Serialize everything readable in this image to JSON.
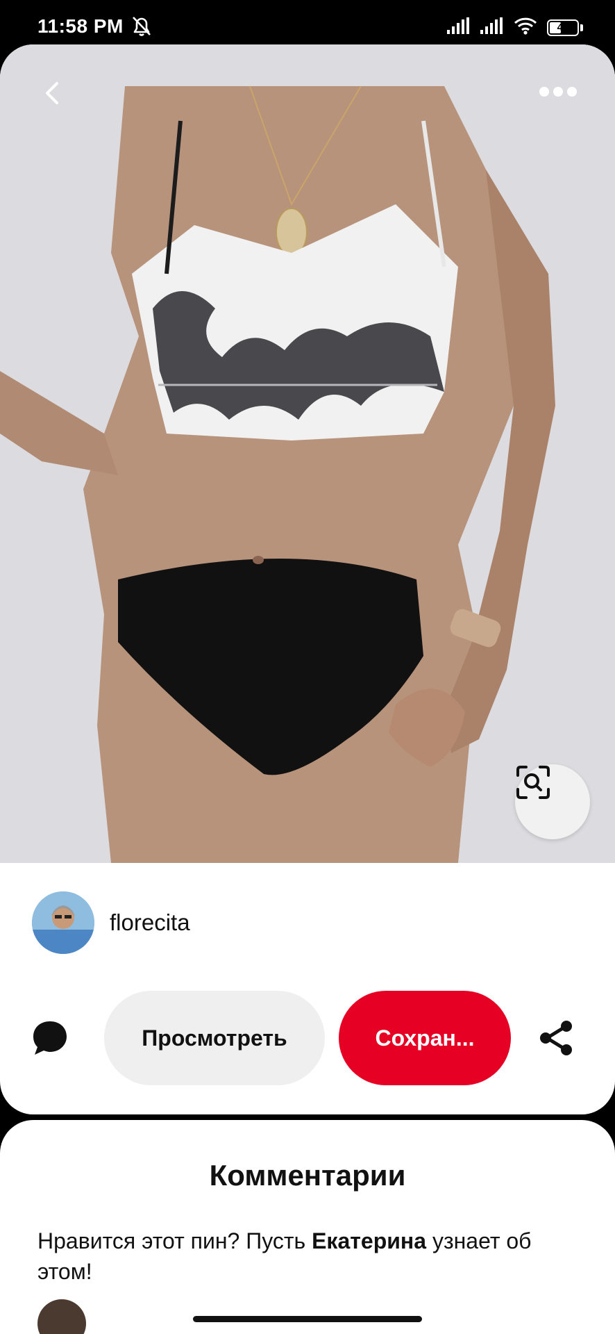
{
  "status_bar": {
    "time": "11:58 PM",
    "battery_level": "41",
    "icons": [
      "alarm-off-icon",
      "signal-icon",
      "signal-icon",
      "wifi-icon",
      "battery-icon"
    ]
  },
  "pin": {
    "image_description_icon": "swimsuit-photo",
    "back_icon": "chevron-left-icon",
    "more_icon": "more-horizontal-icon",
    "lens_icon": "visual-search-icon"
  },
  "author": {
    "name": "florecita"
  },
  "actions": {
    "view_label": "Просмотреть",
    "save_label": "Сохран...",
    "save_color": "#e60023"
  },
  "comments": {
    "title": "Комментарии",
    "prompt_before": "Нравится этот пин? Пусть ",
    "prompt_name": "Екатерина",
    "prompt_after": " узнает об этом!"
  }
}
